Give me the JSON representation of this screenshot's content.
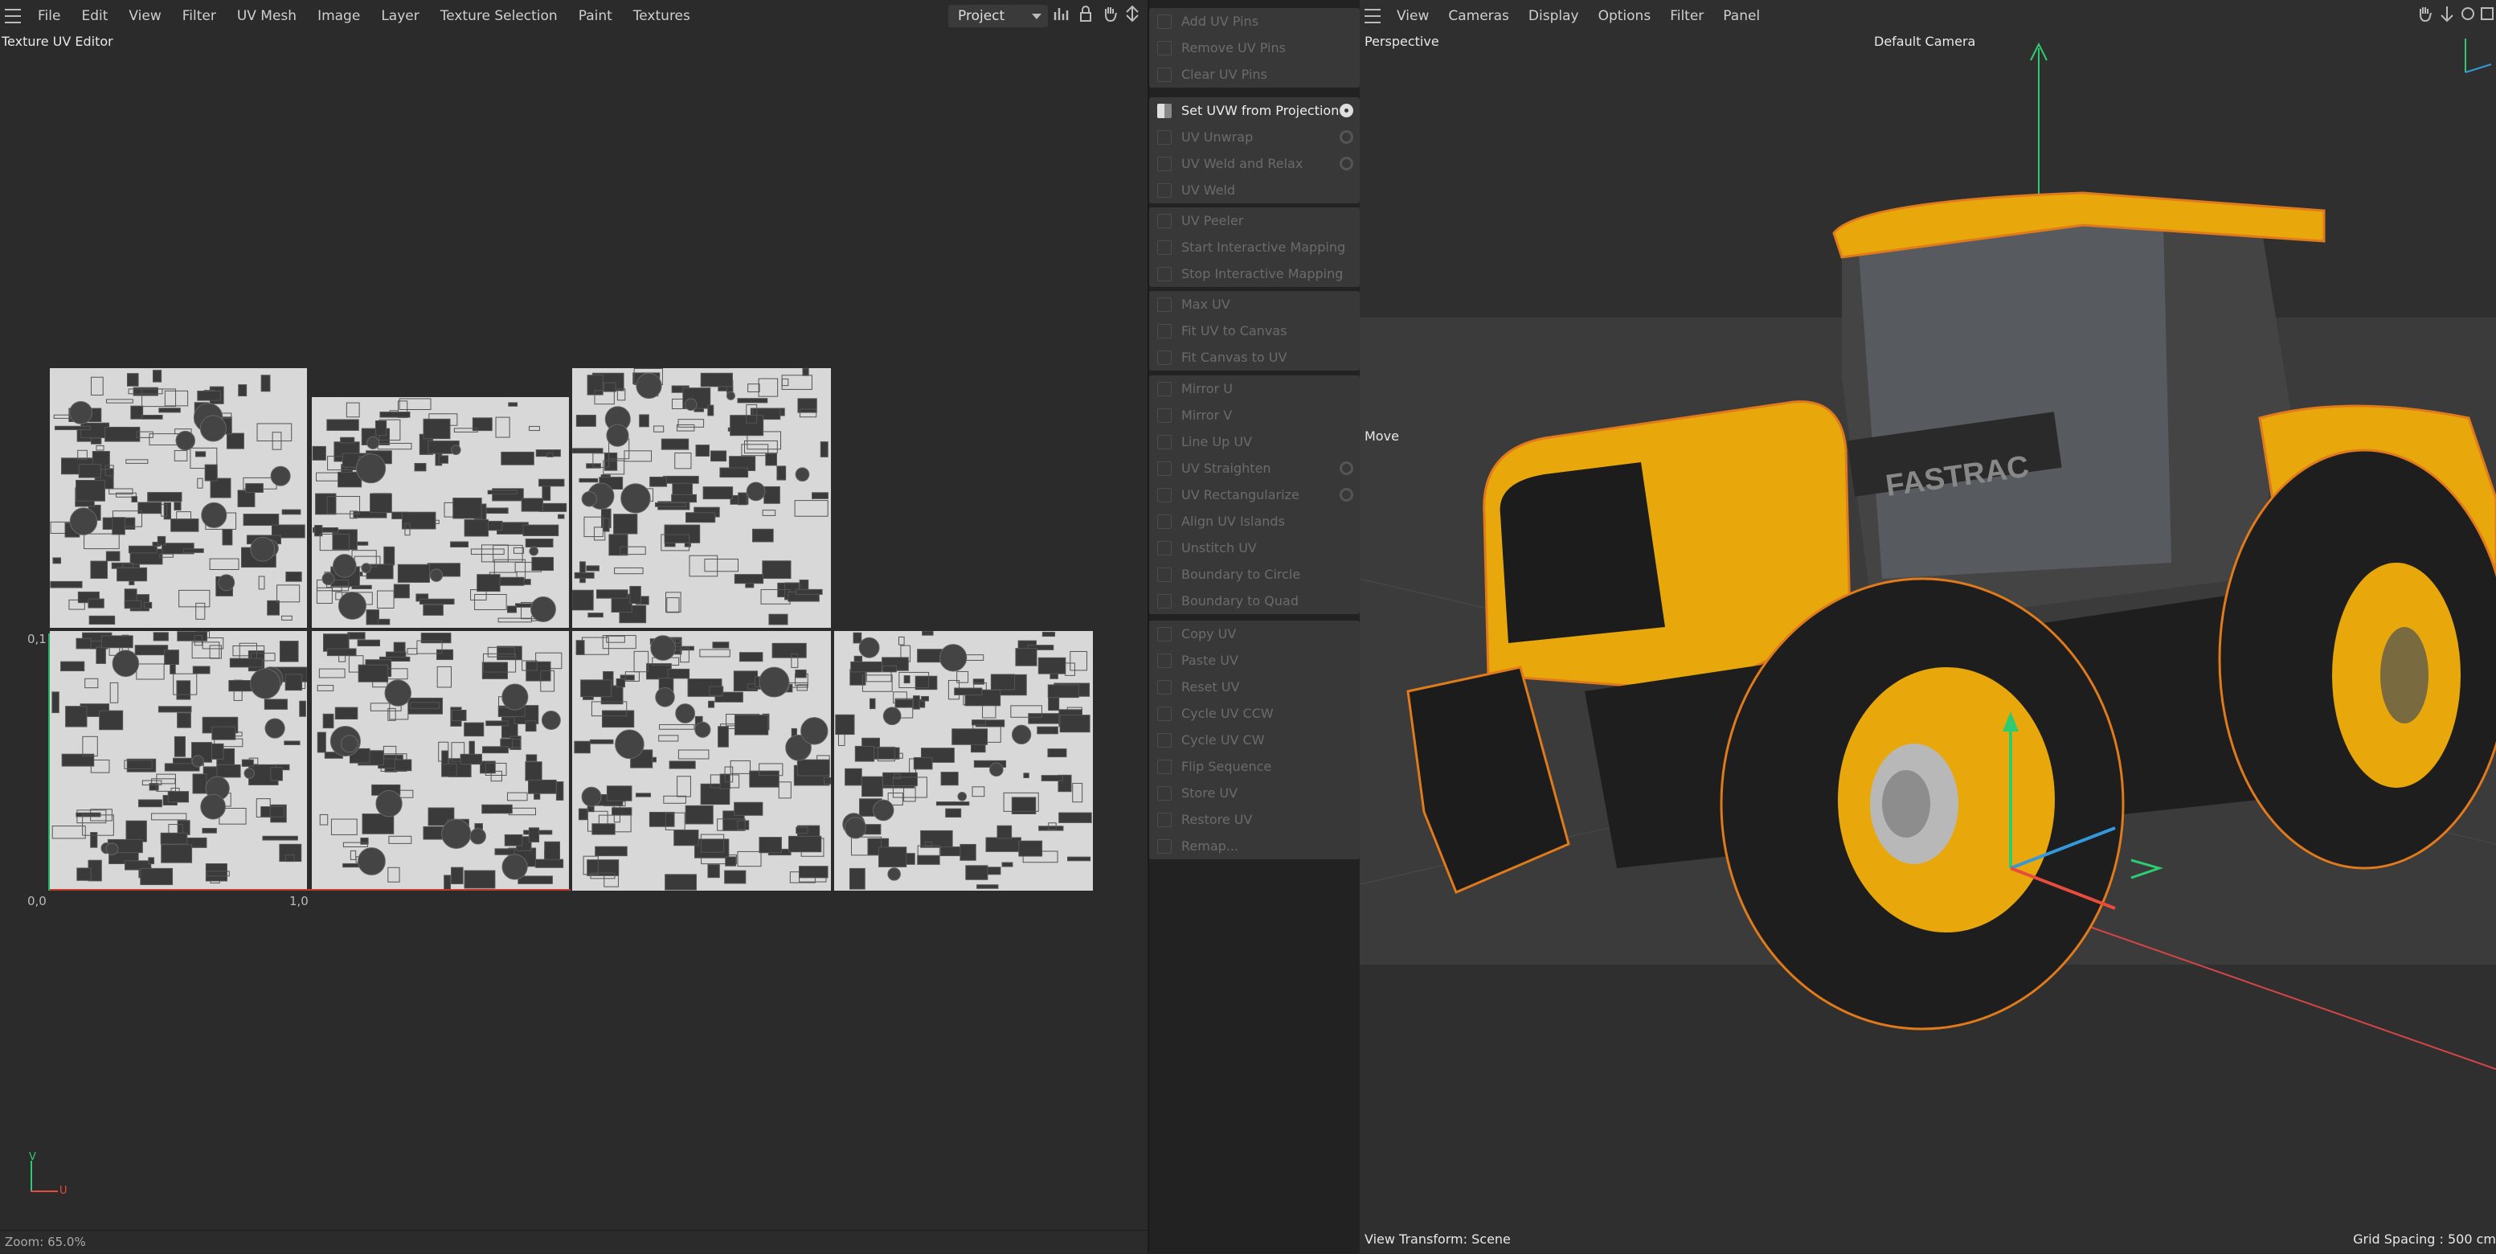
{
  "uv_editor": {
    "menu": [
      "File",
      "Edit",
      "View",
      "Filter",
      "UV Mesh",
      "Image",
      "Layer",
      "Texture Selection",
      "Paint",
      "Textures"
    ],
    "project_select": "Project",
    "title": "Texture UV Editor",
    "coord_origin": "0,0",
    "coord_x": "1,0",
    "coord_y": "0,1",
    "axis_v": "V",
    "axis_u": "U",
    "zoom": "Zoom: 65.0%"
  },
  "tools": {
    "groups": [
      {
        "items": [
          {
            "label": "Add UV Pins"
          },
          {
            "label": "Remove UV Pins"
          },
          {
            "label": "Clear UV Pins"
          }
        ]
      },
      {
        "items": [
          {
            "label": "Set UVW from Projection",
            "active": true,
            "gear": true
          },
          {
            "label": "UV Unwrap",
            "gear": true
          },
          {
            "label": "UV Weld and Relax",
            "gear": true
          },
          {
            "label": "UV Weld"
          }
        ]
      },
      {
        "items": [
          {
            "label": "UV Peeler"
          },
          {
            "label": "Start Interactive Mapping"
          },
          {
            "label": "Stop Interactive Mapping"
          }
        ]
      },
      {
        "items": [
          {
            "label": "Max UV"
          },
          {
            "label": "Fit UV to Canvas"
          },
          {
            "label": "Fit Canvas to UV"
          }
        ]
      },
      {
        "items": [
          {
            "label": "Mirror U"
          },
          {
            "label": "Mirror V"
          },
          {
            "label": "Line Up UV"
          },
          {
            "label": "UV Straighten",
            "gear": true
          },
          {
            "label": "UV Rectangularize",
            "gear": true
          },
          {
            "label": "Align UV Islands"
          },
          {
            "label": "Unstitch UV"
          },
          {
            "label": "Boundary to Circle"
          },
          {
            "label": "Boundary to Quad"
          }
        ]
      },
      {
        "items": [
          {
            "label": "Copy UV"
          },
          {
            "label": "Paste UV"
          },
          {
            "label": "Reset UV"
          },
          {
            "label": "Cycle UV CCW"
          },
          {
            "label": "Cycle UV CW"
          },
          {
            "label": "Flip Sequence"
          },
          {
            "label": "Store UV"
          },
          {
            "label": "Restore UV"
          },
          {
            "label": "Remap..."
          }
        ]
      }
    ]
  },
  "viewport": {
    "menu": [
      "View",
      "Cameras",
      "Display",
      "Options",
      "Filter",
      "Panel"
    ],
    "title": "Perspective",
    "camera": "Default Camera",
    "move_label": "Move",
    "view_transform": "View Transform: Scene",
    "grid_spacing": "Grid Spacing : 500 cm",
    "decal": "FASTRAC",
    "colors": {
      "body": "#e8a80c",
      "tire": "#1e1e1e",
      "outline": "#e07a1a"
    }
  }
}
